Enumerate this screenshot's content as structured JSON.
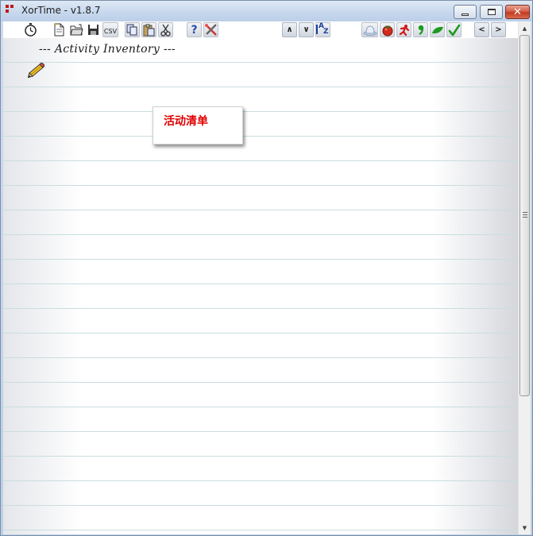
{
  "window": {
    "title": "XorTime - v1.8.7",
    "buttons": {
      "minimize": "minimize",
      "maximize": "maximize",
      "close": "✕"
    }
  },
  "toolbar": {
    "csv_label": "CSV",
    "help_label": "?",
    "up_label": "∧",
    "down_label": "∨",
    "prev_label": "<",
    "next_label": ">",
    "sort_label_a": "A",
    "sort_label_z": "Z",
    "icons": [
      "stopwatch-icon",
      "new-file-icon",
      "open-folder-icon",
      "save-icon",
      "csv-export-icon",
      "copy-icon",
      "paste-icon",
      "cut-icon",
      "help-icon",
      "settings-icon",
      "move-up-icon",
      "move-down-icon",
      "sort-az-icon",
      "hat-icon",
      "tomato-icon",
      "red-figure-icon",
      "green-comma-icon",
      "green-leaf-icon",
      "green-checkmark-icon",
      "previous-icon",
      "next-icon"
    ]
  },
  "page": {
    "title": "--- Activity Inventory ---",
    "note_text": "活动清单"
  },
  "colors": {
    "note_text": "#e00000",
    "rule_line": "#c9dde0",
    "accent_green": "#1e9a1e",
    "accent_red": "#d01818"
  }
}
